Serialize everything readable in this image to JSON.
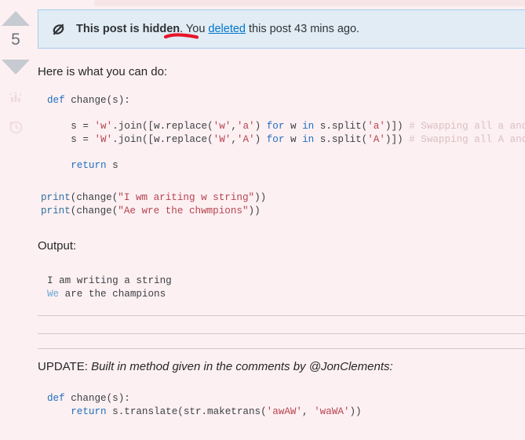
{
  "sidebar": {
    "upvote_label": "Upvote",
    "vote_count": "5",
    "downvote_label": "Downvote",
    "stats_icon": "bar-chart-icon",
    "history_icon": "history-clock-icon"
  },
  "notice": {
    "icon": "hidden-eye-slash-icon",
    "bold_text": "This post is hidden",
    "rest_before_link": ". You ",
    "link_text": "deleted",
    "rest_after_link": " this post 43 mins ago.",
    "background_color": "#e1ecf4",
    "border_color": "#a6ceed",
    "link_color": "#0077cc"
  },
  "annotation": {
    "color": "#e8152a",
    "target": "deleted"
  },
  "body": {
    "intro": "Here is what you can do:",
    "code_block_1": [
      {
        "indent": "",
        "tokens": [
          {
            "t": "def ",
            "c": "kw"
          },
          {
            "t": "change(s):",
            "c": "plain"
          }
        ]
      },
      {
        "indent": "",
        "tokens": [
          {
            "t": "",
            "c": "plain"
          }
        ]
      },
      {
        "indent": "    ",
        "tokens": [
          {
            "t": "s = ",
            "c": "plain"
          },
          {
            "t": "'w'",
            "c": "str"
          },
          {
            "t": ".join([w.replace(",
            "c": "plain"
          },
          {
            "t": "'w'",
            "c": "str"
          },
          {
            "t": ",",
            "c": "plain"
          },
          {
            "t": "'a'",
            "c": "str"
          },
          {
            "t": ") ",
            "c": "plain"
          },
          {
            "t": "for ",
            "c": "kw"
          },
          {
            "t": "w ",
            "c": "plain"
          },
          {
            "t": "in ",
            "c": "kw"
          },
          {
            "t": "s.split(",
            "c": "plain"
          },
          {
            "t": "'a'",
            "c": "str"
          },
          {
            "t": ")]) ",
            "c": "plain"
          },
          {
            "t": "# Swapping all a and w",
            "c": "cmt"
          }
        ]
      },
      {
        "indent": "    ",
        "tokens": [
          {
            "t": "s = ",
            "c": "plain"
          },
          {
            "t": "'W'",
            "c": "str"
          },
          {
            "t": ".join([w.replace(",
            "c": "plain"
          },
          {
            "t": "'W'",
            "c": "str"
          },
          {
            "t": ",",
            "c": "plain"
          },
          {
            "t": "'A'",
            "c": "str"
          },
          {
            "t": ") ",
            "c": "plain"
          },
          {
            "t": "for ",
            "c": "kw"
          },
          {
            "t": "w ",
            "c": "plain"
          },
          {
            "t": "in ",
            "c": "kw"
          },
          {
            "t": "s.split(",
            "c": "plain"
          },
          {
            "t": "'A'",
            "c": "str"
          },
          {
            "t": ")]) ",
            "c": "plain"
          },
          {
            "t": "# Swapping all A and W",
            "c": "cmt"
          }
        ]
      },
      {
        "indent": "",
        "tokens": [
          {
            "t": "",
            "c": "plain"
          }
        ]
      },
      {
        "indent": "    ",
        "tokens": [
          {
            "t": "return ",
            "c": "kw"
          },
          {
            "t": "s",
            "c": "plain"
          }
        ]
      }
    ],
    "code_block_2": [
      {
        "indent": "",
        "tokens": [
          {
            "t": "print",
            "c": "kw2"
          },
          {
            "t": "(change(",
            "c": "plain"
          },
          {
            "t": "\"I wm ariting w string\"",
            "c": "str"
          },
          {
            "t": "))",
            "c": "plain"
          }
        ]
      },
      {
        "indent": "",
        "tokens": [
          {
            "t": "print",
            "c": "kw2"
          },
          {
            "t": "(change(",
            "c": "plain"
          },
          {
            "t": "\"Ae wre the chwmpions\"",
            "c": "str"
          },
          {
            "t": "))",
            "c": "plain"
          }
        ]
      }
    ],
    "output_label": "Output:",
    "output_block": [
      {
        "indent": "",
        "tokens": [
          {
            "t": "I am writing a string",
            "c": "plain"
          }
        ]
      },
      {
        "indent": "",
        "tokens": [
          {
            "t": "We",
            "c": "outblue"
          },
          {
            "t": " are the champions",
            "c": "plain"
          }
        ]
      }
    ],
    "update_prefix": "UPDATE: ",
    "update_italic": "Built in method given in the comments by @JonClements:",
    "code_block_3": [
      {
        "indent": "",
        "tokens": [
          {
            "t": "def ",
            "c": "kw"
          },
          {
            "t": "change(s):",
            "c": "plain"
          }
        ]
      },
      {
        "indent": "    ",
        "tokens": [
          {
            "t": "return ",
            "c": "kw"
          },
          {
            "t": "s.translate(str.maketrans(",
            "c": "plain"
          },
          {
            "t": "'awAW'",
            "c": "str"
          },
          {
            "t": ", ",
            "c": "plain"
          },
          {
            "t": "'waWA'",
            "c": "str"
          },
          {
            "t": "))",
            "c": "plain"
          }
        ]
      }
    ],
    "rule_count": 3
  }
}
